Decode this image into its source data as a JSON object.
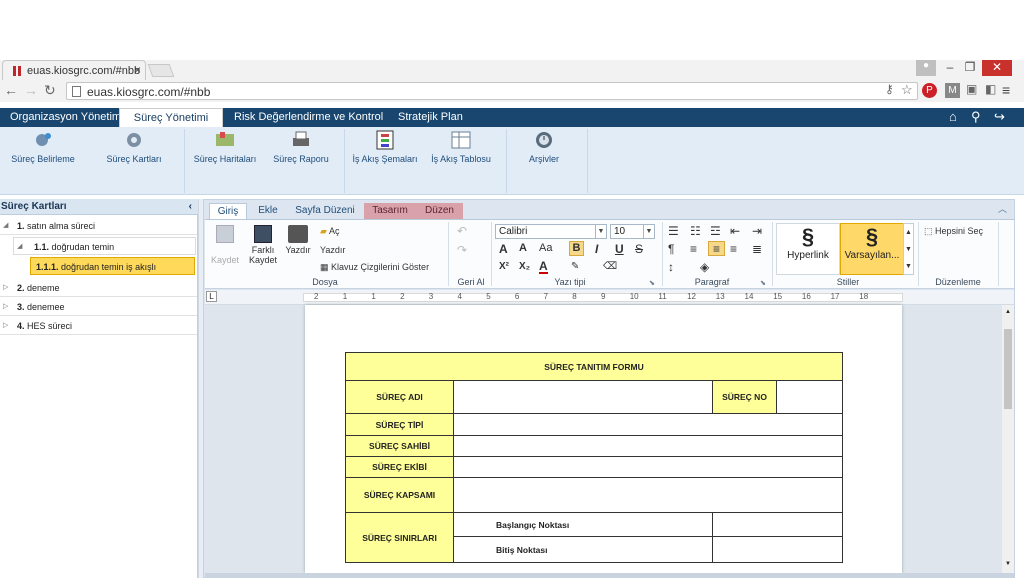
{
  "browser": {
    "tab_title": "euas.kiosgrc.com/#nbb",
    "url": "euas.kiosgrc.com/#nbb"
  },
  "appnav": {
    "items": [
      "Organizasyon Yönetimi",
      "Süreç Yönetimi",
      "Risk Değerlendirme ve Kontrol",
      "Stratejik Plan"
    ],
    "active": "Süreç Yönetimi"
  },
  "toolbar": {
    "items": [
      "Süreç Belirleme",
      "Süreç Kartları",
      "Süreç Haritaları",
      "Süreç Raporu",
      "İş Akış Şemaları",
      "İş Akış Tablosu",
      "Arşivler"
    ]
  },
  "leftpanel": {
    "title": "Süreç Kartları",
    "tree": [
      {
        "num": "1.",
        "label": "satın alma süreci"
      },
      {
        "num": "1.1.",
        "label": "doğrudan temin"
      },
      {
        "num": "1.1.1.",
        "label": "doğrudan temin iş akışlı"
      },
      {
        "num": "2.",
        "label": "deneme"
      },
      {
        "num": "3.",
        "label": "denemee"
      },
      {
        "num": "4.",
        "label": "HES süreci"
      }
    ]
  },
  "ribbon": {
    "tabs": [
      "Giriş",
      "Ekle",
      "Sayfa Düzeni",
      "Tasarım",
      "Düzen"
    ],
    "active_tab": "Giriş",
    "dosya": {
      "kaydet": "Kaydet",
      "farkli_kaydet_1": "Farklı",
      "farkli_kaydet_2": "Kaydet",
      "yazdir": "Yazdır",
      "ac": "Aç",
      "yazdir2": "Yazdır",
      "kilavuz": "Klavuz Çizgilerini Göster",
      "label": "Dosya"
    },
    "geri_al_label": "Geri Al",
    "yazi_tipi": {
      "font": "Calibri",
      "size": "10",
      "label": "Yazı tipi"
    },
    "paragraf_label": "Paragraf",
    "stiller": {
      "hyperlink": "Hyperlink",
      "varsayilan": "Varsayılan...",
      "label": "Stiller"
    },
    "duzenleme": {
      "hepsini_sec": "Hepsini Seç",
      "label": "Düzenleme"
    }
  },
  "ruler": {
    "ticks": [
      "2",
      "1",
      "1",
      "2",
      "3",
      "4",
      "5",
      "6",
      "7",
      "8",
      "9",
      "10",
      "11",
      "12",
      "13",
      "14",
      "15",
      "16",
      "17",
      "18"
    ]
  },
  "document": {
    "title": "SÜREÇ TANITIM FORMU",
    "surec_adi": "SÜREÇ ADI",
    "surec_no": "SÜREÇ NO",
    "surec_tipi": "SÜREÇ TİPİ",
    "surec_sahibi": "SÜREÇ SAHİBİ",
    "surec_ekibi": "SÜREÇ EKİBİ",
    "surec_kapsami": "SÜREÇ KAPSAMI",
    "surec_sinirlari": "SÜREÇ SINIRLARI",
    "baslangic": "Başlangıç Noktası",
    "bitis": "Bitiş Noktası"
  }
}
